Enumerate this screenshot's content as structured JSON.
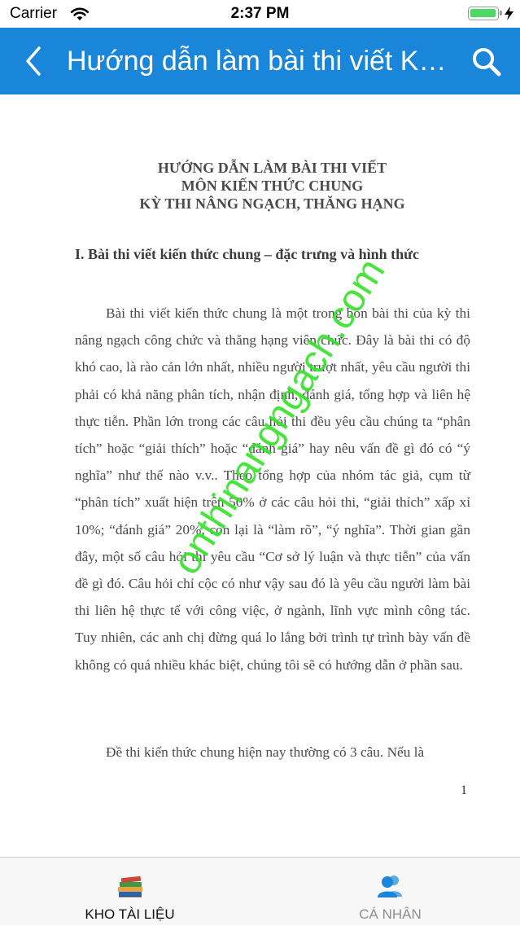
{
  "status_bar": {
    "carrier": "Carrier",
    "time": "2:37 PM",
    "battery_level_pct": 100,
    "battery_color": "#4cd964"
  },
  "nav_bar": {
    "title": "Hướng dẫn làm bài thi viết Kiến thức chung",
    "background": "#1a86d9",
    "back_icon": "chevron-left-icon",
    "search_icon": "search-icon"
  },
  "document": {
    "title_lines": [
      "HƯỚNG DẪN LÀM BÀI THI VIẾT",
      "MÔN KIẾN THỨC CHUNG",
      "KỲ THI NÂNG NGẠCH, THĂNG HẠNG"
    ],
    "section_heading": "I. Bài thi viết kiến thức chung – đặc trưng và hình thức",
    "paragraph_1": "Bài thi viết kiến thức chung là một trong bốn bài thi của kỳ thi nâng ngạch công chức và thăng hạng viên chức. Đây là bài thi có độ khó cao, là rào cản lớn nhất, nhiều người trượt nhất, yêu cầu người thi phải có khả năng phân tích, nhận định, đánh giá, tổng hợp và liên hệ thực tiễn. Phần lớn trong các câu hỏi thi đều yêu cầu chúng ta “phân tích” hoặc “giải thích” hoặc “đánh giá” hay nêu vấn đề gì đó có “ý nghĩa” như thế nào v.v.. Theo tổng hợp của nhóm tác giả, cụm từ “phân tích” xuất hiện trên 50% ở các câu hỏi thi, “giải thích” xấp xỉ 10%; “đánh giá” 20%, còn lại là “làm rõ”, “ý nghĩa”. Thời gian gần đây, một số câu hỏi thi yêu cầu “Cơ sở lý luận và thực tiễn” của vấn đề gì đó. Câu hỏi chỉ cộc có như vậy sau đó là yêu cầu người làm bài thi liên hệ thực tế với công việc, ở ngành, lĩnh vực mình công tác. Tuy nhiên, các anh chị đừng quá lo lắng bởi trình tự trình bày vấn đề không có quá nhiều khác biệt, chúng tôi sẽ có hướng dẫn ở phần sau.",
    "paragraph_2": "Đề thi kiến thức chung hiện nay thường có 3 câu. Nếu là",
    "page_number": "1",
    "watermark": "onthinangngach.com",
    "watermark_color": "#35e22a"
  },
  "tab_bar": {
    "tabs": [
      {
        "label": "KHO TÀI LIỆU",
        "icon": "books-icon",
        "active": true
      },
      {
        "label": "CÁ NHÂN",
        "icon": "users-icon",
        "active": false
      }
    ]
  }
}
